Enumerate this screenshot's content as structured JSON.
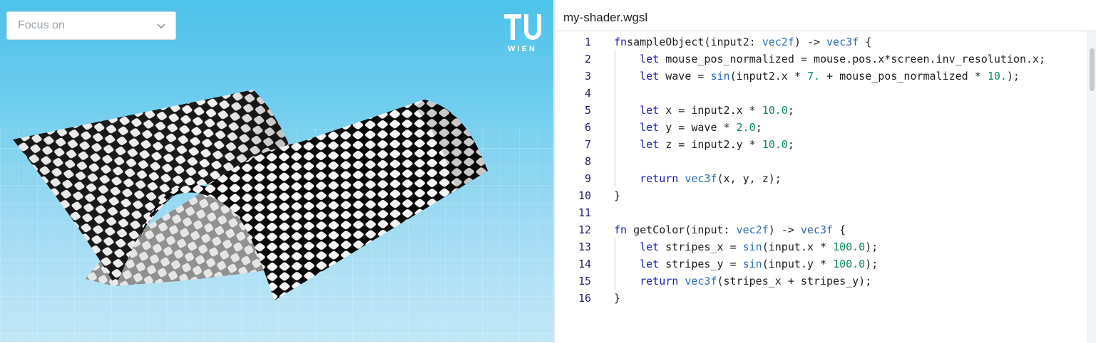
{
  "viewport": {
    "focus_select": {
      "value": "Focus on"
    },
    "logo": {
      "top": "TU",
      "bottom": "WIEN"
    }
  },
  "editor": {
    "tab_title": "my-shader.wgsl",
    "lines": [
      {
        "n": "1",
        "tokens": [
          [
            "kw",
            "fn"
          ],
          [
            "",
            "sampleObject(input2: "
          ],
          [
            "ty",
            "vec2f"
          ],
          [
            "",
            ") -> "
          ],
          [
            "ty",
            "vec3f"
          ],
          [
            "",
            " {"
          ]
        ]
      },
      {
        "n": "2",
        "tokens": [
          [
            "",
            "    "
          ],
          [
            "kw",
            "let"
          ],
          [
            "",
            " mouse_pos_normalized = mouse.pos.x*screen.inv_resolution.x;"
          ]
        ]
      },
      {
        "n": "3",
        "tokens": [
          [
            "",
            "    "
          ],
          [
            "kw",
            "let"
          ],
          [
            "",
            " wave = "
          ],
          [
            "fnc",
            "sin"
          ],
          [
            "",
            "(input2.x * "
          ],
          [
            "num",
            "7."
          ],
          [
            "",
            " + mouse_pos_normalized * "
          ],
          [
            "num",
            "10."
          ],
          [
            "",
            ");"
          ]
        ]
      },
      {
        "n": "4",
        "tokens": []
      },
      {
        "n": "5",
        "tokens": [
          [
            "",
            "    "
          ],
          [
            "kw",
            "let"
          ],
          [
            "",
            " x = input2.x * "
          ],
          [
            "num",
            "10.0"
          ],
          [
            "",
            ";"
          ]
        ]
      },
      {
        "n": "6",
        "tokens": [
          [
            "",
            "    "
          ],
          [
            "kw",
            "let"
          ],
          [
            "",
            " y = wave * "
          ],
          [
            "num",
            "2.0"
          ],
          [
            "",
            ";"
          ]
        ]
      },
      {
        "n": "7",
        "tokens": [
          [
            "",
            "    "
          ],
          [
            "kw",
            "let"
          ],
          [
            "",
            " z = input2.y * "
          ],
          [
            "num",
            "10.0"
          ],
          [
            "",
            ";"
          ]
        ]
      },
      {
        "n": "8",
        "tokens": []
      },
      {
        "n": "9",
        "tokens": [
          [
            "",
            "    "
          ],
          [
            "kw",
            "return"
          ],
          [
            "",
            " "
          ],
          [
            "ty",
            "vec3f"
          ],
          [
            "",
            "(x, y, z);"
          ]
        ]
      },
      {
        "n": "10",
        "tokens": [
          [
            "",
            "}"
          ]
        ]
      },
      {
        "n": "11",
        "tokens": []
      },
      {
        "n": "12",
        "tokens": [
          [
            "kw",
            "fn"
          ],
          [
            "",
            " getColor(input: "
          ],
          [
            "ty",
            "vec2f"
          ],
          [
            "",
            ") -> "
          ],
          [
            "ty",
            "vec3f"
          ],
          [
            "",
            " {"
          ]
        ]
      },
      {
        "n": "13",
        "tokens": [
          [
            "",
            "    "
          ],
          [
            "kw",
            "let"
          ],
          [
            "",
            " stripes_x = "
          ],
          [
            "fnc",
            "sin"
          ],
          [
            "",
            "(input.x * "
          ],
          [
            "num",
            "100.0"
          ],
          [
            "",
            ");"
          ]
        ]
      },
      {
        "n": "14",
        "tokens": [
          [
            "",
            "    "
          ],
          [
            "kw",
            "let"
          ],
          [
            "",
            " stripes_y = "
          ],
          [
            "fnc",
            "sin"
          ],
          [
            "",
            "(input.y * "
          ],
          [
            "num",
            "100.0"
          ],
          [
            "",
            ");"
          ]
        ]
      },
      {
        "n": "15",
        "tokens": [
          [
            "",
            "    "
          ],
          [
            "kw",
            "return"
          ],
          [
            "",
            " "
          ],
          [
            "ty",
            "vec3f"
          ],
          [
            "",
            "(stripes_x + stripes_y);"
          ]
        ]
      },
      {
        "n": "16",
        "tokens": [
          [
            "",
            "}"
          ]
        ]
      }
    ]
  },
  "colors": {
    "keyword": "#1a1ab8",
    "type": "#2c6ab5",
    "number": "#0b8a5a",
    "line_number": "#1d1d6b",
    "logo": "#3fb2d8"
  }
}
